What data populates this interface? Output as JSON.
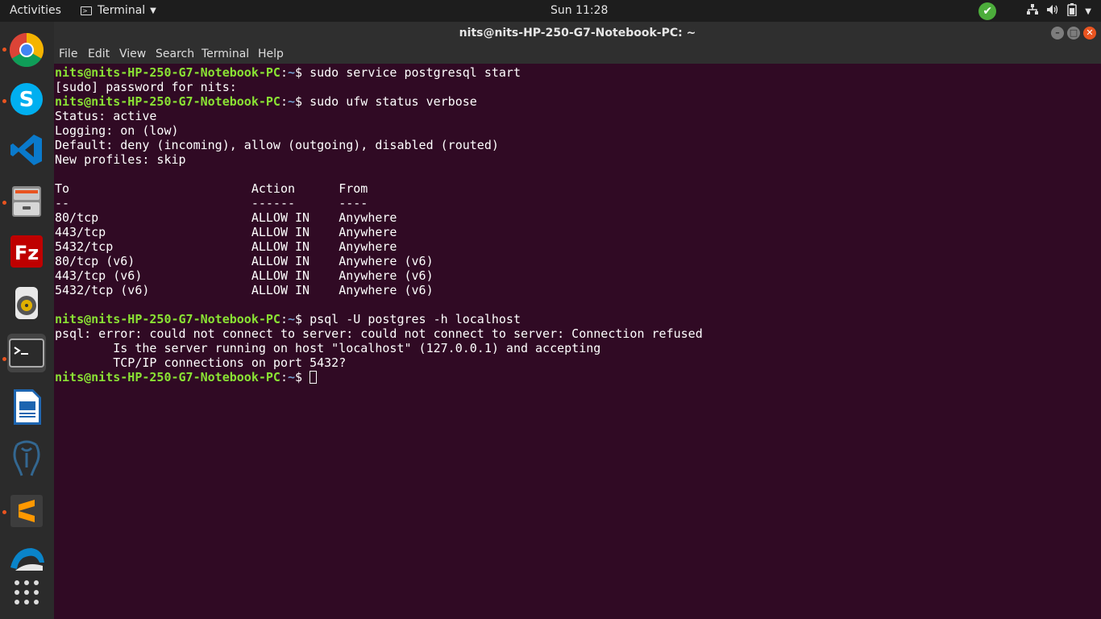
{
  "topbar": {
    "activities": "Activities",
    "app_name": "Terminal",
    "clock": "Sun 11:28",
    "tray_icons": [
      "check-icon",
      "network-icon",
      "volume-icon",
      "battery-icon",
      "chevron-down-icon"
    ]
  },
  "dock": {
    "apps": [
      {
        "name": "chrome",
        "running": true
      },
      {
        "name": "skype",
        "running": true
      },
      {
        "name": "vscode",
        "running": false
      },
      {
        "name": "file-manager",
        "running": true
      },
      {
        "name": "filezilla",
        "running": false
      },
      {
        "name": "media-player",
        "running": false
      },
      {
        "name": "terminal",
        "running": true
      },
      {
        "name": "writer",
        "running": false
      },
      {
        "name": "pgadmin",
        "running": false
      },
      {
        "name": "sublime",
        "running": true
      },
      {
        "name": "thunderbird",
        "running": false
      },
      {
        "name": "show-apps",
        "running": false
      }
    ]
  },
  "window": {
    "title": "nits@nits-HP-250-G7-Notebook-PC: ~",
    "menu": [
      "File",
      "Edit",
      "View",
      "Search",
      "Terminal",
      "Help"
    ]
  },
  "terminal": {
    "prompt_user": "nits@nits-HP-250-G7-Notebook-PC",
    "prompt_colon": ":",
    "prompt_path": "~",
    "prompt_dollar": "$ ",
    "cmd1": "sudo service postgresql start",
    "out1": "[sudo] password for nits:",
    "cmd2": "sudo ufw status verbose",
    "out2": [
      "Status: active",
      "Logging: on (low)",
      "Default: deny (incoming), allow (outgoing), disabled (routed)",
      "New profiles: skip",
      "",
      "To                         Action      From",
      "--                         ------      ----",
      "80/tcp                     ALLOW IN    Anywhere",
      "443/tcp                    ALLOW IN    Anywhere",
      "5432/tcp                   ALLOW IN    Anywhere",
      "80/tcp (v6)                ALLOW IN    Anywhere (v6)",
      "443/tcp (v6)               ALLOW IN    Anywhere (v6)",
      "5432/tcp (v6)              ALLOW IN    Anywhere (v6)",
      ""
    ],
    "cmd3": "psql -U postgres -h localhost",
    "out3": [
      "psql: error: could not connect to server: could not connect to server: Connection refused",
      "        Is the server running on host \"localhost\" (127.0.0.1) and accepting",
      "        TCP/IP connections on port 5432?"
    ]
  },
  "colors": {
    "terminal_bg": "#300a24",
    "prompt_user": "#8ae234",
    "prompt_path": "#729fcf",
    "accent": "#e95420"
  }
}
